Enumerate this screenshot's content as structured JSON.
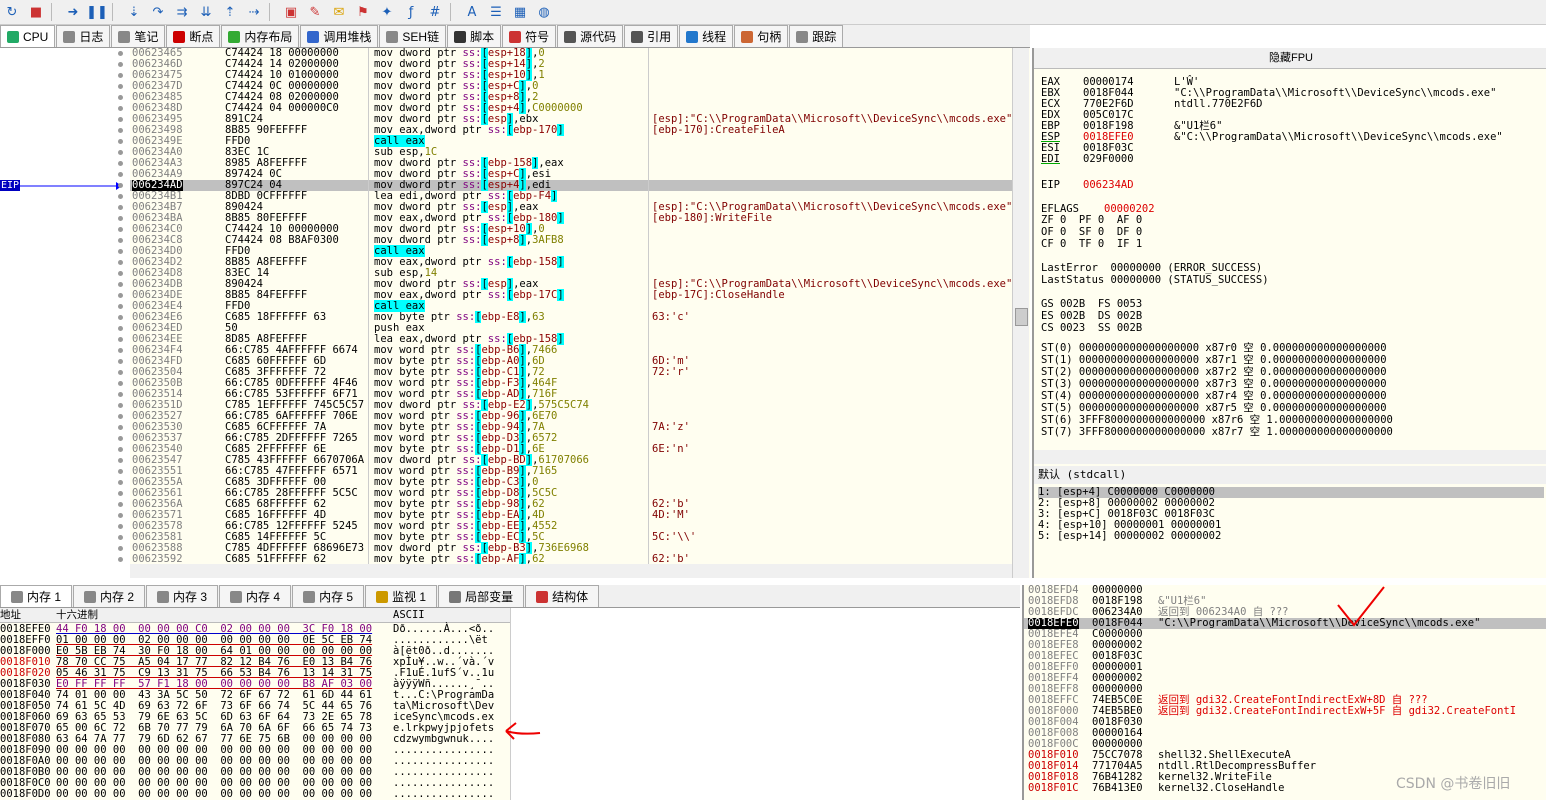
{
  "toolbar": {
    "icons": [
      "restart-icon",
      "stop-icon",
      "run-icon",
      "pause-icon",
      "step-into-icon",
      "step-over-icon",
      "trace-into-icon",
      "trace-over-icon",
      "execute-till-return-icon",
      "run-to-user-code-icon",
      "scylla-icon",
      "patch-icon",
      "comment-icon",
      "label-icon",
      "bookmark-icon",
      "function-icon",
      "hash-icon",
      "font-icon",
      "script-icon",
      "calculator-icon",
      "globe-icon"
    ]
  },
  "tabs": [
    {
      "label": "CPU",
      "color": "#2a6"
    },
    {
      "label": "日志",
      "color": "#888"
    },
    {
      "label": "笔记",
      "color": "#888"
    },
    {
      "label": "断点",
      "color": "#c00"
    },
    {
      "label": "内存布局",
      "color": "#3a3"
    },
    {
      "label": "调用堆栈",
      "color": "#36c"
    },
    {
      "label": "SEH链",
      "color": "#888"
    },
    {
      "label": "脚本",
      "color": "#333"
    },
    {
      "label": "符号",
      "color": "#c33"
    },
    {
      "label": "源代码",
      "color": "#555"
    },
    {
      "label": "引用",
      "color": "#555"
    },
    {
      "label": "线程",
      "color": "#27c"
    },
    {
      "label": "句柄",
      "color": "#c63"
    },
    {
      "label": "跟踪",
      "color": "#888"
    }
  ],
  "eip_label": "EIP",
  "disasm": [
    {
      "addr": "00623465",
      "hex": "C74424 18 00000000",
      "ins": "mov dword ptr ss:[esp+18],0",
      "cmt": ""
    },
    {
      "addr": "0062346D",
      "hex": "C74424 14 02000000",
      "ins": "mov dword ptr ss:[esp+14],2",
      "cmt": ""
    },
    {
      "addr": "00623475",
      "hex": "C74424 10 01000000",
      "ins": "mov dword ptr ss:[esp+10],1",
      "cmt": ""
    },
    {
      "addr": "0062347D",
      "hex": "C74424 0C 00000000",
      "ins": "mov dword ptr ss:[esp+C],0",
      "cmt": ""
    },
    {
      "addr": "00623485",
      "hex": "C74424 08 02000000",
      "ins": "mov dword ptr ss:[esp+8],2",
      "cmt": ""
    },
    {
      "addr": "0062348D",
      "hex": "C74424 04 000000C0",
      "ins": "mov dword ptr ss:[esp+4],C0000000",
      "cmt": ""
    },
    {
      "addr": "00623495",
      "hex": "891C24",
      "ins": "mov dword ptr ss:[esp],ebx",
      "cmt": "[esp]:\"C:\\\\ProgramData\\\\Microsoft\\\\DeviceSync\\\\mcods.exe\""
    },
    {
      "addr": "00623498",
      "hex": "8B85 90FEFFFF",
      "ins": "mov eax,dword ptr ss:[ebp-170]",
      "cmt": "[ebp-170]:CreateFileA"
    },
    {
      "addr": "0062349E",
      "hex": "FFD0",
      "ins": "call eax",
      "cmt": ""
    },
    {
      "addr": "006234A0",
      "hex": "83EC 1C",
      "ins": "sub esp,1C",
      "cmt": ""
    },
    {
      "addr": "006234A3",
      "hex": "8985 A8FEFFFF",
      "ins": "mov dword ptr ss:[ebp-158],eax",
      "cmt": ""
    },
    {
      "addr": "006234A9",
      "hex": "897424 0C",
      "ins": "mov dword ptr ss:[esp+C],esi",
      "cmt": ""
    },
    {
      "addr": "006234AD",
      "hex": "897C24 04",
      "ins": "mov dword ptr ss:[esp+4],edi",
      "cmt": ""
    },
    {
      "addr": "006234B1",
      "hex": "8DBD 0CFFFFFF",
      "ins": "lea edi,dword ptr ss:[ebp-F4]",
      "cmt": ""
    },
    {
      "addr": "006234B7",
      "hex": "890424",
      "ins": "mov dword ptr ss:[esp],eax",
      "cmt": "[esp]:\"C:\\\\ProgramData\\\\Microsoft\\\\DeviceSync\\\\mcods.exe\""
    },
    {
      "addr": "006234BA",
      "hex": "8B85 80FEFFFF",
      "ins": "mov eax,dword ptr ss:[ebp-180]",
      "cmt": "[ebp-180]:WriteFile"
    },
    {
      "addr": "006234C0",
      "hex": "C74424 10 00000000",
      "ins": "mov dword ptr ss:[esp+10],0",
      "cmt": ""
    },
    {
      "addr": "006234C8",
      "hex": "C74424 08 B8AF0300",
      "ins": "mov dword ptr ss:[esp+8],3AFB8",
      "cmt": ""
    },
    {
      "addr": "006234D0",
      "hex": "FFD0",
      "ins": "call eax",
      "cmt": ""
    },
    {
      "addr": "006234D2",
      "hex": "8B85 A8FEFFFF",
      "ins": "mov eax,dword ptr ss:[ebp-158]",
      "cmt": ""
    },
    {
      "addr": "006234D8",
      "hex": "83EC 14",
      "ins": "sub esp,14",
      "cmt": ""
    },
    {
      "addr": "006234DB",
      "hex": "890424",
      "ins": "mov dword ptr ss:[esp],eax",
      "cmt": "[esp]:\"C:\\\\ProgramData\\\\Microsoft\\\\DeviceSync\\\\mcods.exe\""
    },
    {
      "addr": "006234DE",
      "hex": "8B85 84FEFFFF",
      "ins": "mov eax,dword ptr ss:[ebp-17C]",
      "cmt": "[ebp-17C]:CloseHandle"
    },
    {
      "addr": "006234E4",
      "hex": "FFD0",
      "ins": "call eax",
      "cmt": ""
    },
    {
      "addr": "006234E6",
      "hex": "C685 18FFFFFF 63",
      "ins": "mov byte ptr ss:[ebp-E8],63",
      "cmt": "63:'c'"
    },
    {
      "addr": "006234ED",
      "hex": "50",
      "ins": "push eax",
      "cmt": ""
    },
    {
      "addr": "006234EE",
      "hex": "8D85 A8FEFFFF",
      "ins": "lea eax,dword ptr ss:[ebp-158]",
      "cmt": ""
    },
    {
      "addr": "006234F4",
      "hex": "66:C785 4AFFFFFF 6674",
      "ins": "mov word ptr ss:[ebp-B6],7466",
      "cmt": ""
    },
    {
      "addr": "006234FD",
      "hex": "C685 60FFFFFF 6D",
      "ins": "mov byte ptr ss:[ebp-A0],6D",
      "cmt": "6D:'m'"
    },
    {
      "addr": "00623504",
      "hex": "C685 3FFFFFFF 72",
      "ins": "mov byte ptr ss:[ebp-C1],72",
      "cmt": "72:'r'"
    },
    {
      "addr": "0062350B",
      "hex": "66:C785 0DFFFFFF 4F46",
      "ins": "mov word ptr ss:[ebp-F3],464F",
      "cmt": ""
    },
    {
      "addr": "00623514",
      "hex": "66:C785 53FFFFFF 6F71",
      "ins": "mov word ptr ss:[ebp-AD],716F",
      "cmt": ""
    },
    {
      "addr": "0062351D",
      "hex": "C785 1EFFFFFF 745C5C57",
      "ins": "mov dword ptr ss:[ebp-E2],575C5C74",
      "cmt": ""
    },
    {
      "addr": "00623527",
      "hex": "66:C785 6AFFFFFF 706E",
      "ins": "mov word ptr ss:[ebp-96],6E70",
      "cmt": ""
    },
    {
      "addr": "00623530",
      "hex": "C685 6CFFFFFF 7A",
      "ins": "mov byte ptr ss:[ebp-94],7A",
      "cmt": "7A:'z'"
    },
    {
      "addr": "00623537",
      "hex": "66:C785 2DFFFFFF 7265",
      "ins": "mov word ptr ss:[ebp-D3],6572",
      "cmt": ""
    },
    {
      "addr": "00623540",
      "hex": "C685 2FFFFFFF 6E",
      "ins": "mov byte ptr ss:[ebp-D1],6E",
      "cmt": "6E:'n'"
    },
    {
      "addr": "00623547",
      "hex": "C785 43FFFFFF 6670706A",
      "ins": "mov dword ptr ss:[ebp-BD],61707066",
      "cmt": ""
    },
    {
      "addr": "00623551",
      "hex": "66:C785 47FFFFFF 6571",
      "ins": "mov word ptr ss:[ebp-B9],7165",
      "cmt": ""
    },
    {
      "addr": "0062355A",
      "hex": "C685 3DFFFFFF 00",
      "ins": "mov byte ptr ss:[ebp-C3],0",
      "cmt": ""
    },
    {
      "addr": "00623561",
      "hex": "66:C785 28FFFFFF 5C5C",
      "ins": "mov word ptr ss:[ebp-D8],5C5C",
      "cmt": ""
    },
    {
      "addr": "0062356A",
      "hex": "C685 68FFFFFF 62",
      "ins": "mov byte ptr ss:[ebp-98],62",
      "cmt": "62:'b'"
    },
    {
      "addr": "00623571",
      "hex": "C685 16FFFFFF 4D",
      "ins": "mov byte ptr ss:[ebp-EA],4D",
      "cmt": "4D:'M'"
    },
    {
      "addr": "00623578",
      "hex": "66:C785 12FFFFFF 5245",
      "ins": "mov word ptr ss:[ebp-EE],4552",
      "cmt": ""
    },
    {
      "addr": "00623581",
      "hex": "C685 14FFFFFF 5C",
      "ins": "mov byte ptr ss:[ebp-EC],5C",
      "cmt": "5C:'\\\\'"
    },
    {
      "addr": "00623588",
      "hex": "C785 4DFFFFFF 68696E73",
      "ins": "mov dword ptr ss:[ebp-B3],736E6968",
      "cmt": ""
    },
    {
      "addr": "00623592",
      "hex": "C685 51FFFFFF 62",
      "ins": "mov byte ptr ss:[ebp-AF],62",
      "cmt": "62:'b'"
    }
  ],
  "regs": {
    "hide_fpu": "隐藏FPU",
    "gp": [
      {
        "n": "EAX",
        "v": "00000174",
        "c": "L'Ŵ'"
      },
      {
        "n": "EBX",
        "v": "0018F044",
        "c": "\"C:\\\\ProgramData\\\\Microsoft\\\\DeviceSync\\\\mcods.exe\""
      },
      {
        "n": "ECX",
        "v": "770E2F6D",
        "c": "ntdll.770E2F6D"
      },
      {
        "n": "EDX",
        "v": "005C017C",
        "c": ""
      },
      {
        "n": "EBP",
        "v": "0018F198",
        "c": "&\"U1栏6\""
      },
      {
        "n": "ESP",
        "v": "0018EFE0",
        "c": "&\"C:\\\\ProgramData\\\\Microsoft\\\\DeviceSync\\\\mcods.exe\""
      },
      {
        "n": "ESI",
        "v": "0018F03C",
        "c": ""
      },
      {
        "n": "EDI",
        "v": "029F0000",
        "c": ""
      }
    ],
    "eip": {
      "n": "EIP",
      "v": "006234AD"
    },
    "eflags": {
      "n": "EFLAGS",
      "v": "00000202"
    },
    "flags": [
      "ZF 0  PF 0  AF 0",
      "OF 0  SF 0  DF 0",
      "CF 0  TF 0  IF 1"
    ],
    "lasterror": "LastError  00000000 (ERROR_SUCCESS)",
    "laststatus": "LastStatus 00000000 (STATUS_SUCCESS)",
    "segs": [
      "GS 002B  FS 0053",
      "ES 002B  DS 002B",
      "CS 0023  SS 002B"
    ],
    "st": [
      "ST(0) 0000000000000000000 x87r0 空 0.000000000000000000",
      "ST(1) 0000000000000000000 x87r1 空 0.000000000000000000",
      "ST(2) 0000000000000000000 x87r2 空 0.000000000000000000",
      "ST(3) 0000000000000000000 x87r3 空 0.000000000000000000",
      "ST(4) 0000000000000000000 x87r4 空 0.000000000000000000",
      "ST(5) 0000000000000000000 x87r5 空 0.000000000000000000",
      "ST(6) 3FFF8000000000000000 x87r6 空 1.000000000000000000",
      "ST(7) 3FFF8000000000000000 x87r7 空 1.000000000000000000"
    ]
  },
  "args": {
    "head": "默认 (stdcall)",
    "rows": [
      "1: [esp+4] C0000000 C0000000",
      "2: [esp+8] 00000002 00000002",
      "3: [esp+C] 0018F03C 0018F03C",
      "4: [esp+10] 00000001 00000001",
      "5: [esp+14] 00000002 00000002"
    ]
  },
  "btabs": [
    "内存 1",
    "内存 2",
    "内存 3",
    "内存 4",
    "内存 5",
    "监视 1",
    "局部变量",
    "结构体"
  ],
  "dump": {
    "col_addr": "地址",
    "col_hex": "十六进制",
    "col_ascii": "ASCII",
    "rows": [
      {
        "a": "0018EFE0",
        "h": "44 F0 18 00  00 00 00 C0  02 00 00 00  3C F0 18 00",
        "s": "Dð......À...<ð..",
        "red": false
      },
      {
        "a": "0018EFF0",
        "h": "01 00 00 00  02 00 00 00  00 00 00 00  0E 5C EB 74",
        "s": "............\\ët",
        "red": false
      },
      {
        "a": "0018F000",
        "h": "E0 5B EB 74  30 F0 18 00  64 01 00 00  00 00 00 00",
        "s": "à[ët0ð..d.......",
        "red": false
      },
      {
        "a": "0018F010",
        "h": "78 70 CC 75  A5 04 17 77  82 12 B4 76  E0 13 B4 76",
        "s": "xpÌu¥..w..´và.´v",
        "red": true
      },
      {
        "a": "0018F020",
        "h": "05 46 31 75  C9 13 31 75  66 53 B4 76  13 14 31 75",
        "s": ".F1uÉ.1ufS´v..1u",
        "red": true
      },
      {
        "a": "0018F030",
        "h": "E0 FF FF FF  57 F1 18 00  00 00 00 00  B8 AF 03 00",
        "s": "àÿÿÿWñ......¸¯..",
        "red": false
      },
      {
        "a": "0018F040",
        "h": "74 01 00 00  43 3A 5C 50  72 6F 67 72  61 6D 44 61",
        "s": "t...C:\\ProgramDa",
        "red": false
      },
      {
        "a": "0018F050",
        "h": "74 61 5C 4D  69 63 72 6F  73 6F 66 74  5C 44 65 76",
        "s": "ta\\Microsoft\\Dev",
        "red": false
      },
      {
        "a": "0018F060",
        "h": "69 63 65 53  79 6E 63 5C  6D 63 6F 64  73 2E 65 78",
        "s": "iceSync\\mcods.ex",
        "red": false
      },
      {
        "a": "0018F070",
        "h": "65 00 6C 72  6B 70 77 79  6A 70 6A 6F  66 65 74 73",
        "s": "e.lrkpwyjpjofets",
        "red": false
      },
      {
        "a": "0018F080",
        "h": "63 64 7A 77  79 6D 62 67  77 6E 75 6B  00 00 00 00",
        "s": "cdzwymbgwnuk....",
        "red": false
      },
      {
        "a": "0018F090",
        "h": "00 00 00 00  00 00 00 00  00 00 00 00  00 00 00 00",
        "s": "................",
        "red": false
      },
      {
        "a": "0018F0A0",
        "h": "00 00 00 00  00 00 00 00  00 00 00 00  00 00 00 00",
        "s": "................",
        "red": false
      },
      {
        "a": "0018F0B0",
        "h": "00 00 00 00  00 00 00 00  00 00 00 00  00 00 00 00",
        "s": "................",
        "red": false
      },
      {
        "a": "0018F0C0",
        "h": "00 00 00 00  00 00 00 00  00 00 00 00  00 00 00 00",
        "s": "................",
        "red": false
      },
      {
        "a": "0018F0D0",
        "h": "00 00 00 00  00 00 00 00  00 00 00 00  00 00 00 00",
        "s": "................",
        "red": false
      }
    ]
  },
  "stack": [
    {
      "a": "0018EFD4",
      "v": "00000000",
      "c": "",
      "t": ""
    },
    {
      "a": "0018EFD8",
      "v": "0018F198",
      "c": "&\"U1栏6\"",
      "t": ""
    },
    {
      "a": "0018EFDC",
      "v": "006234A0",
      "c": "返回到 006234A0 自 ???",
      "t": ""
    },
    {
      "a": "0018EFE0",
      "v": "0018F044",
      "c": "\"C:\\\\ProgramData\\\\Microsoft\\\\DeviceSync\\\\mcods.exe\"",
      "t": "sel"
    },
    {
      "a": "0018EFE4",
      "v": "C0000000",
      "c": "",
      "t": ""
    },
    {
      "a": "0018EFE8",
      "v": "00000002",
      "c": "",
      "t": ""
    },
    {
      "a": "0018EFEC",
      "v": "0018F03C",
      "c": "",
      "t": ""
    },
    {
      "a": "0018EFF0",
      "v": "00000001",
      "c": "",
      "t": ""
    },
    {
      "a": "0018EFF4",
      "v": "00000002",
      "c": "",
      "t": ""
    },
    {
      "a": "0018EFF8",
      "v": "00000000",
      "c": "",
      "t": ""
    },
    {
      "a": "0018EFFC",
      "v": "74EB5C0E",
      "c": "返回到 gdi32.CreateFontIndirectExW+8D 自 ???",
      "t": "red"
    },
    {
      "a": "0018F000",
      "v": "74EB5BE0",
      "c": "返回到 gdi32.CreateFontIndirectExW+5F 自 gdi32.CreateFontI",
      "t": "red"
    },
    {
      "a": "0018F004",
      "v": "0018F030",
      "c": "",
      "t": ""
    },
    {
      "a": "0018F008",
      "v": "00000164",
      "c": "",
      "t": ""
    },
    {
      "a": "0018F00C",
      "v": "00000000",
      "c": "",
      "t": ""
    },
    {
      "a": "0018F010",
      "v": "75CC7078",
      "c": "shell32.ShellExecuteA",
      "t": "blk"
    },
    {
      "a": "0018F014",
      "v": "771704A5",
      "c": "ntdll.RtlDecompressBuffer",
      "t": "blk"
    },
    {
      "a": "0018F018",
      "v": "76B41282",
      "c": "kernel32.WriteFile",
      "t": "blk"
    },
    {
      "a": "0018F01C",
      "v": "76B413E0",
      "c": "kernel32.CloseHandle",
      "t": "blk"
    }
  ],
  "watermark": "CSDN @书卷旧旧"
}
